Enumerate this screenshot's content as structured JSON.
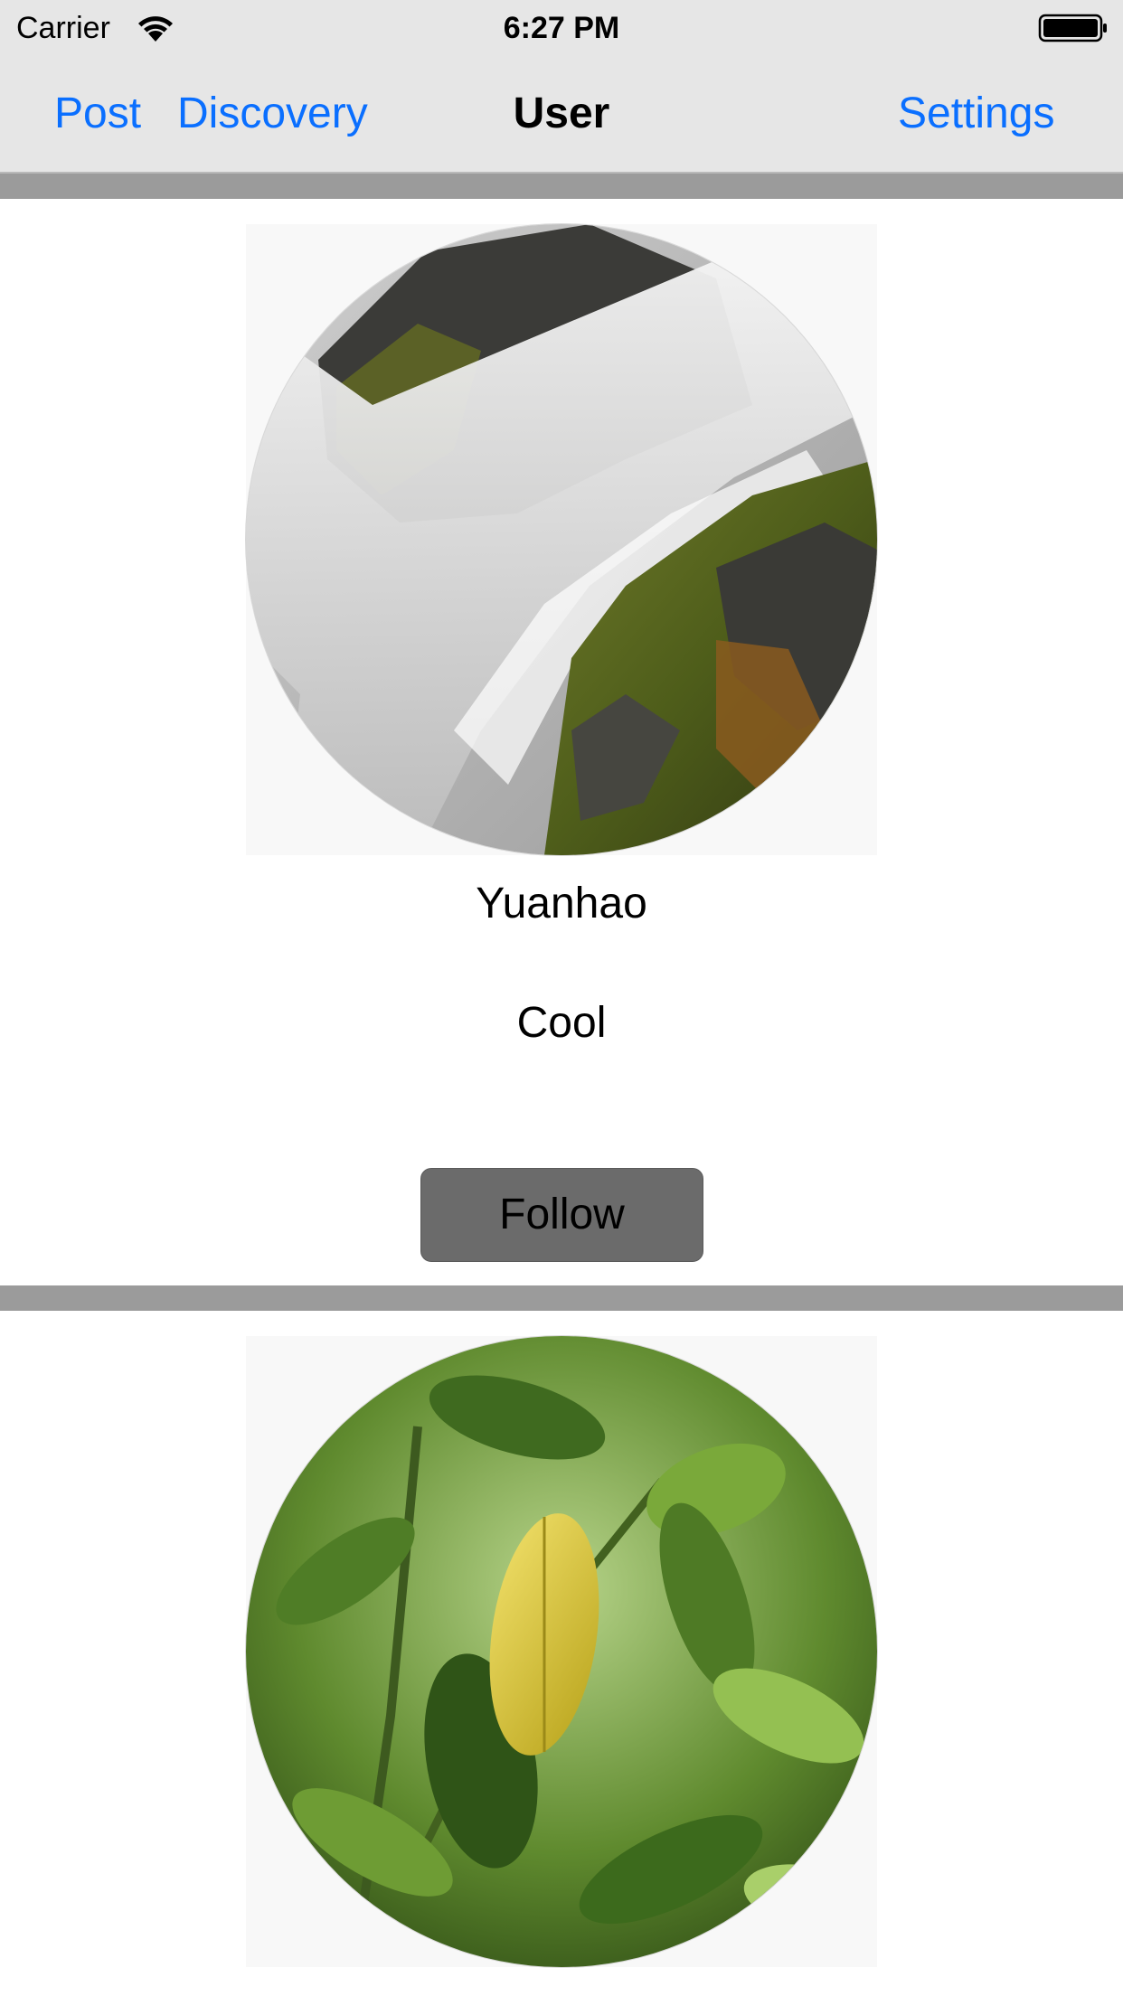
{
  "status_bar": {
    "carrier": "Carrier",
    "time": "6:27 PM",
    "wifi_icon": "wifi-icon",
    "battery_icon": "battery-full-icon"
  },
  "nav": {
    "left_items": [
      "Post",
      "Discovery"
    ],
    "title": "User",
    "right_item": "Settings",
    "accent_color": "#0a6fff"
  },
  "profiles": [
    {
      "avatar": "waterfall-photo",
      "name": "Yuanhao",
      "bio": "Cool",
      "follow_label": "Follow"
    },
    {
      "avatar": "leaves-photo"
    }
  ],
  "colors": {
    "nav_background": "#e6e6e6",
    "separator": "#9b9b9b",
    "follow_button": "#6b6b6b"
  }
}
